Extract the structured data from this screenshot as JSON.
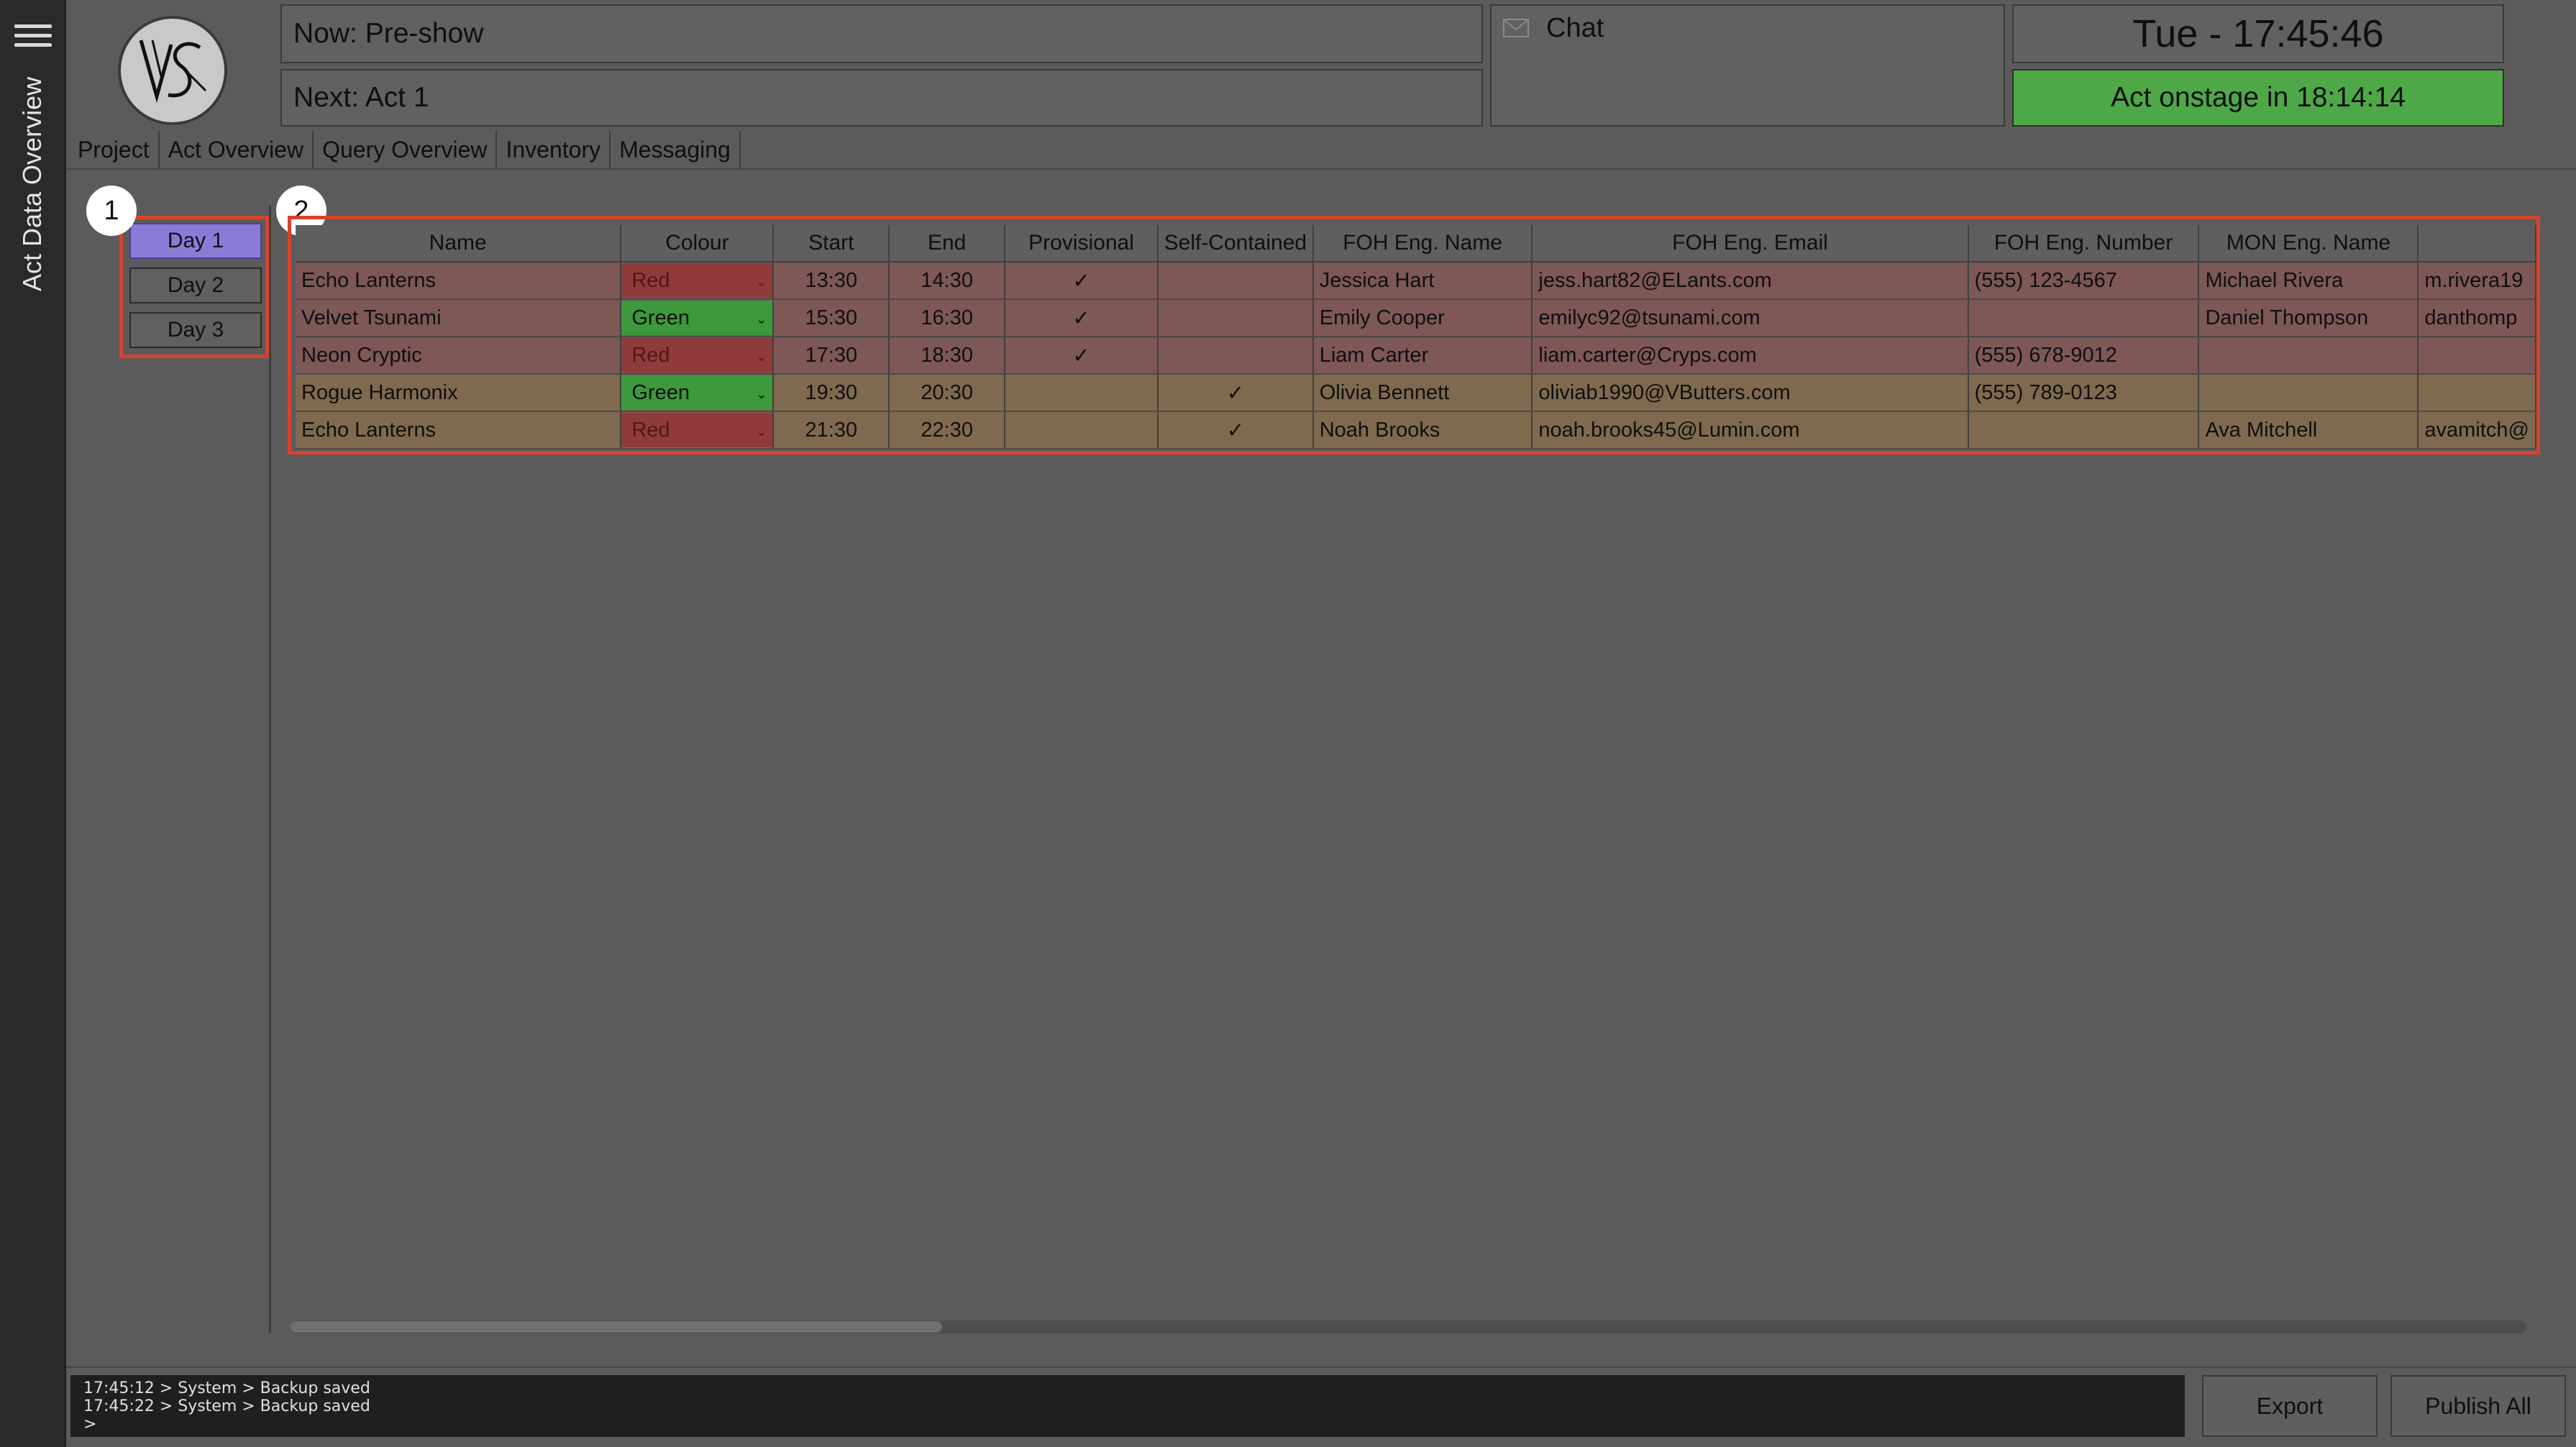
{
  "sidebar": {
    "title": "Act Data Overview",
    "menu_icon": "hamburger-menu-icon"
  },
  "header": {
    "logo_text": "VS",
    "now": "Now: Pre-show",
    "next": "Next: Act 1",
    "chat_label": "Chat",
    "chat_icon": "envelope-icon",
    "clock": "Tue - 17:45:46",
    "onstage": "Act onstage in 18:14:14",
    "onstage_color": "#4ea848"
  },
  "tabs": [
    "Project",
    "Act Overview",
    "Query Overview",
    "Inventory",
    "Messaging"
  ],
  "badges": [
    "1",
    "2"
  ],
  "days": {
    "items": [
      "Day 1",
      "Day 2",
      "Day 3"
    ],
    "selected": "Day 1",
    "selected_color": "#8a7bd6"
  },
  "table": {
    "columns": [
      "Name",
      "Colour",
      "Start",
      "End",
      "Provisional",
      "Self-Contained",
      "FOH Eng. Name",
      "FOH Eng. Email",
      "FOH Eng. Number",
      "MON Eng. Name",
      ""
    ],
    "rows": [
      {
        "name": "Echo Lanterns",
        "colour": "Red",
        "start": "13:30",
        "end": "14:30",
        "provisional": "✓",
        "self_contained": "",
        "foh_name": "Jessica Hart",
        "foh_email": "jess.hart82@ELants.com",
        "foh_number": "(555) 123-4567",
        "mon_name": "Michael Rivera",
        "mon_email": "m.rivera19"
      },
      {
        "name": "Velvet Tsunami",
        "colour": "Green",
        "start": "15:30",
        "end": "16:30",
        "provisional": "✓",
        "self_contained": "",
        "foh_name": "Emily Cooper",
        "foh_email": "emilyc92@tsunami.com",
        "foh_number": "",
        "mon_name": "Daniel Thompson",
        "mon_email": "danthomp"
      },
      {
        "name": "Neon Cryptic",
        "colour": "Red",
        "start": "17:30",
        "end": "18:30",
        "provisional": "✓",
        "self_contained": "",
        "foh_name": "Liam Carter",
        "foh_email": "liam.carter@Cryps.com",
        "foh_number": "(555) 678-9012",
        "mon_name": "",
        "mon_email": ""
      },
      {
        "name": "Rogue Harmonix",
        "colour": "Green",
        "start": "19:30",
        "end": "20:30",
        "provisional": "",
        "self_contained": "✓",
        "foh_name": "Olivia Bennett",
        "foh_email": "oliviab1990@VButters.com",
        "foh_number": "(555) 789-0123",
        "mon_name": "",
        "mon_email": ""
      },
      {
        "name": "Echo Lanterns",
        "colour": "Red",
        "start": "21:30",
        "end": "22:30",
        "provisional": "",
        "self_contained": "✓",
        "foh_name": "Noah Brooks",
        "foh_email": "noah.brooks45@Lumin.com",
        "foh_number": "",
        "mon_name": "Ava Mitchell",
        "mon_email": "avamitch@"
      }
    ]
  },
  "log": {
    "lines": [
      "17:45:12 > System > Backup saved",
      "17:45:22 > System > Backup saved",
      ">"
    ]
  },
  "buttons": {
    "export": "Export",
    "publish": "Publish All"
  },
  "colors": {
    "red": "#8f3b3b",
    "green": "#3e983c",
    "accent_outline": "#d9412e"
  }
}
